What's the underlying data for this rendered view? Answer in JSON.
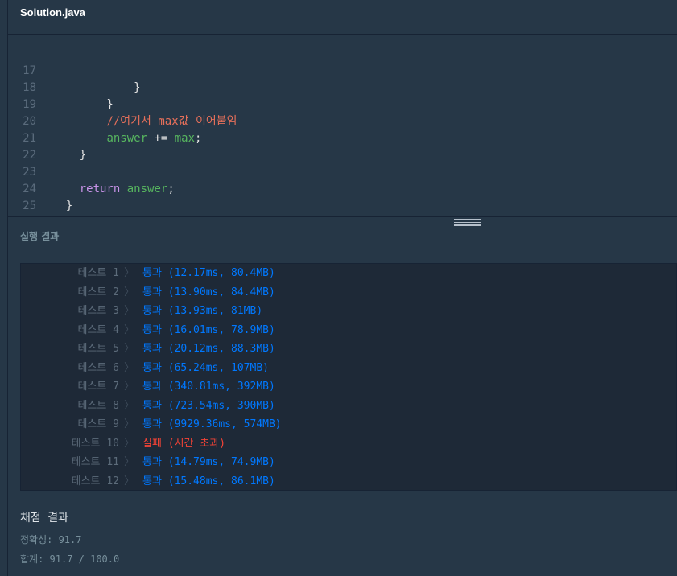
{
  "file_tab": {
    "title": "Solution.java"
  },
  "editor": {
    "lines": [
      {
        "num": "17",
        "code": "            }"
      },
      {
        "num": "18",
        "code": "        }"
      },
      {
        "num": "19",
        "comment": "//여기서 max값 이어붙임"
      },
      {
        "num": "20",
        "assign_var": "answer",
        "assign_op": " += ",
        "assign_val": "max",
        "assign_end": ";"
      },
      {
        "num": "21",
        "code": "    }"
      },
      {
        "num": "22",
        "code": ""
      },
      {
        "num": "23",
        "kw": "return",
        "ret_var": "answer",
        "ret_end": ";"
      },
      {
        "num": "24",
        "code": "}"
      },
      {
        "num": "25",
        "code": "}"
      }
    ]
  },
  "results": {
    "header": "실행 결과",
    "tests": [
      {
        "label": "테스트 1",
        "result": "통과 (12.17ms, 80.4MB)",
        "status": "pass"
      },
      {
        "label": "테스트 2",
        "result": "통과 (13.90ms, 84.4MB)",
        "status": "pass"
      },
      {
        "label": "테스트 3",
        "result": "통과 (13.93ms, 81MB)",
        "status": "pass"
      },
      {
        "label": "테스트 4",
        "result": "통과 (16.01ms, 78.9MB)",
        "status": "pass"
      },
      {
        "label": "테스트 5",
        "result": "통과 (20.12ms, 88.3MB)",
        "status": "pass"
      },
      {
        "label": "테스트 6",
        "result": "통과 (65.24ms, 107MB)",
        "status": "pass"
      },
      {
        "label": "테스트 7",
        "result": "통과 (340.81ms, 392MB)",
        "status": "pass"
      },
      {
        "label": "테스트 8",
        "result": "통과 (723.54ms, 390MB)",
        "status": "pass"
      },
      {
        "label": "테스트 9",
        "result": "통과 (9929.36ms, 574MB)",
        "status": "pass"
      },
      {
        "label": "테스트 10",
        "result": "실패 (시간 초과)",
        "status": "fail"
      },
      {
        "label": "테스트 11",
        "result": "통과 (14.79ms, 74.9MB)",
        "status": "pass"
      },
      {
        "label": "테스트 12",
        "result": "통과 (15.48ms, 86.1MB)",
        "status": "pass"
      }
    ],
    "chevron": "〉"
  },
  "grading": {
    "title": "채점 결과",
    "accuracy": "정확성: 91.7",
    "total": "합계: 91.7 / 100.0"
  },
  "colors": {
    "background": "#263747",
    "pass": "#0078ff",
    "fail": "#f44336",
    "comment": "#e46f5a",
    "variable": "#57b65f",
    "keyword": "#c893e8"
  }
}
